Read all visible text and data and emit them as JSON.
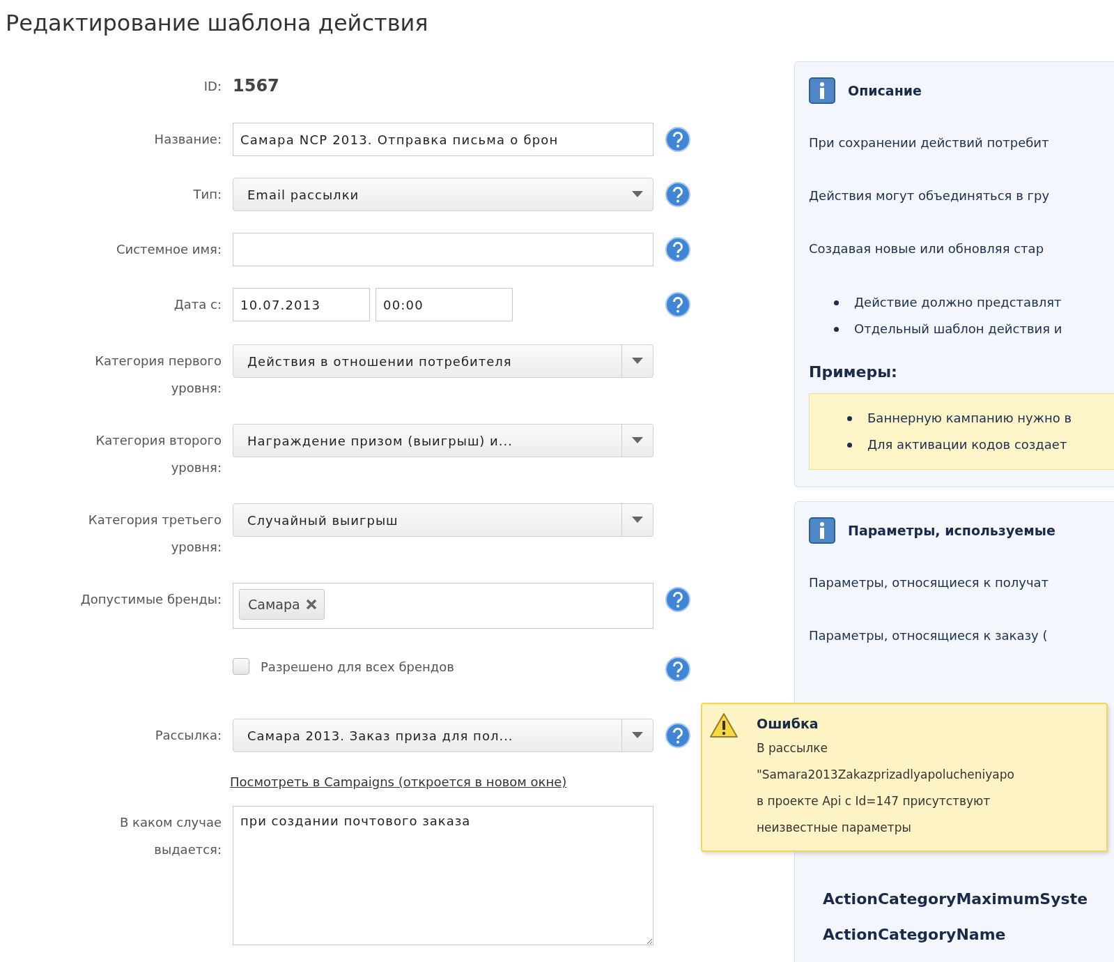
{
  "page_title": "Редактирование шаблона действия",
  "form": {
    "rows": [
      {
        "kind": "static",
        "label": "ID:",
        "value": "1567",
        "help": false
      },
      {
        "kind": "text",
        "label": "Название:",
        "value": "Самара NCP 2013. Отправка письма о брон",
        "help": true
      },
      {
        "kind": "select",
        "label": "Тип:",
        "value": "Email рассылки",
        "help": true
      },
      {
        "kind": "text",
        "label": "Системное имя:",
        "help": true
      },
      {
        "kind": "date",
        "label": "Дата с:",
        "date": "10.07.2013",
        "time": "00:00",
        "help": true
      },
      {
        "kind": "combo",
        "label": "Категория первого уровня:",
        "value": "Действия в отношении потребителя",
        "help": false
      },
      {
        "kind": "combo",
        "label": "Категория второго уровня:",
        "value": "Награждение призом (выигрыш) и...",
        "help": false
      },
      {
        "kind": "combo",
        "label": "Категория третьего уровня:",
        "value": "Случайный выигрыш",
        "help": false
      },
      {
        "kind": "tags",
        "label": "Допустимые бренды:",
        "tags": [
          "Самара"
        ],
        "help": true
      },
      {
        "kind": "checkbox",
        "text": "Разрешено для всех брендов",
        "checked": false,
        "help": true
      },
      {
        "kind": "combo",
        "label": "Рассылка:",
        "value": "Самара 2013. Заказ приза для пол...",
        "help": true
      },
      {
        "kind": "link",
        "text": "Посмотреть в Campaigns (откроется в новом окне)"
      },
      {
        "kind": "textarea",
        "label": "В каком случае выдается:",
        "value": "при создании почтового заказа",
        "help": false
      }
    ]
  },
  "description_panel": {
    "title": "Описание",
    "paragraphs": [
      "При сохранении действий потребит",
      "Действия могут объединяться в гру",
      "Создавая новые или обновляя стар"
    ],
    "bullets": [
      "Действие должно представлят",
      "Отдельный шаблон действия и"
    ],
    "examples_title": "Примеры:",
    "examples": [
      "Баннерную кампанию нужно в",
      "Для активации кодов создает"
    ]
  },
  "params_panel": {
    "title": "Параметры, используемые",
    "paragraphs": [
      "Параметры, относящиеся к получат",
      "Параметры, относящиеся к заказу ("
    ],
    "params": [
      "ActionCategoryMaximumSyste",
      "ActionCategoryName"
    ]
  },
  "error_tooltip": {
    "title": "Ошибка",
    "lines": [
      "В рассылке",
      "\"Samara2013Zakazprizadlyapolucheniyapo",
      "в проекте Api с Id=147 присутствуют",
      "неизвестные параметры"
    ]
  }
}
